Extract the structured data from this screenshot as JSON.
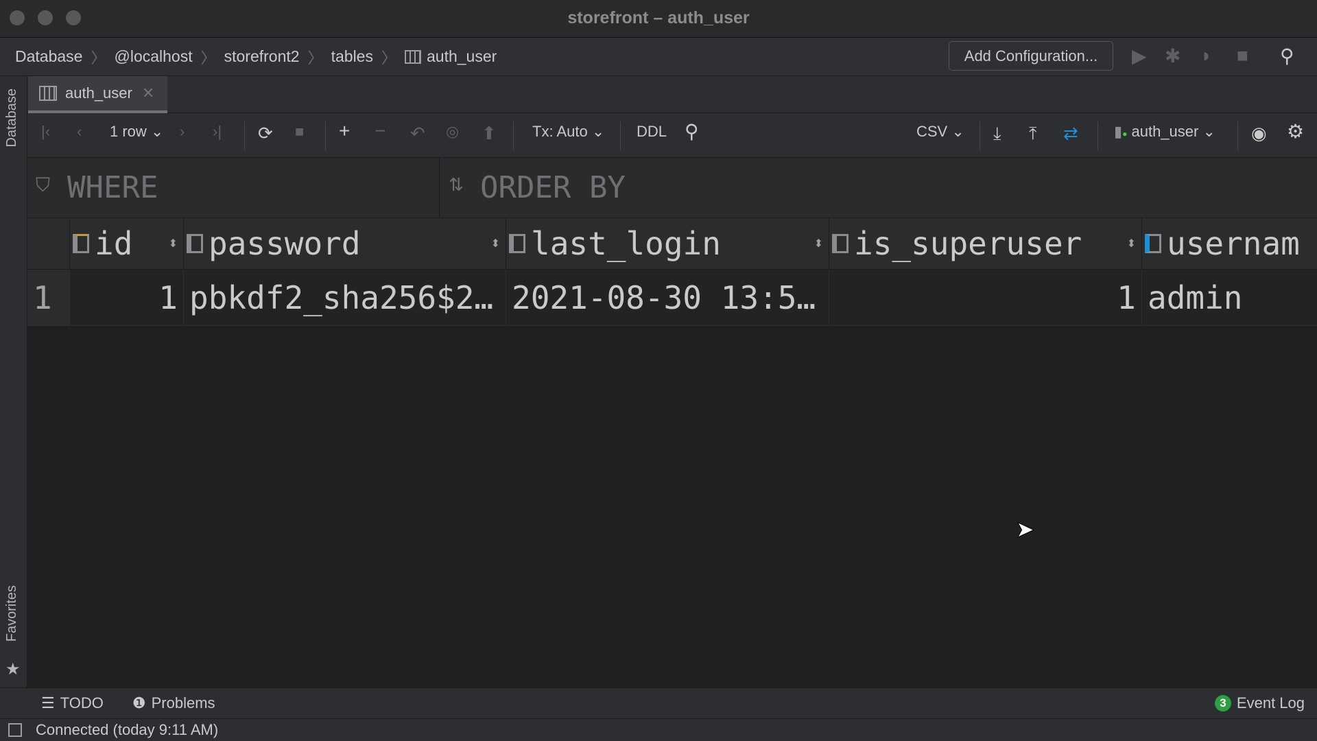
{
  "window": {
    "title": "storefront – auth_user"
  },
  "breadcrumb": [
    "Database",
    "@localhost",
    "storefront2",
    "tables",
    "auth_user"
  ],
  "header": {
    "add_configuration": "Add Configuration..."
  },
  "side": {
    "database": "Database",
    "favorites": "Favorites"
  },
  "tab": {
    "label": "auth_user"
  },
  "toolbar": {
    "rows": "1 row",
    "tx": "Tx: Auto",
    "ddl": "DDL",
    "format": "CSV",
    "schema": "auth_user"
  },
  "filter": {
    "where": "WHERE",
    "order_by": "ORDER BY"
  },
  "table": {
    "columns": [
      "id",
      "password",
      "last_login",
      "is_superuser",
      "usernam"
    ],
    "rows": [
      {
        "num": "1",
        "cells": [
          "1",
          "pbkdf2_sha256$2…",
          "2021-08-30 13:5…",
          "1",
          "admin"
        ]
      }
    ]
  },
  "bottom": {
    "todo": "TODO",
    "problems": "Problems",
    "event_count": "3",
    "event_log": "Event Log"
  },
  "status": {
    "text": "Connected (today 9:11 AM)"
  },
  "colors": {
    "accent": "#1e8fd6",
    "badge": "#2ea043",
    "connected": "#3fd13f"
  }
}
